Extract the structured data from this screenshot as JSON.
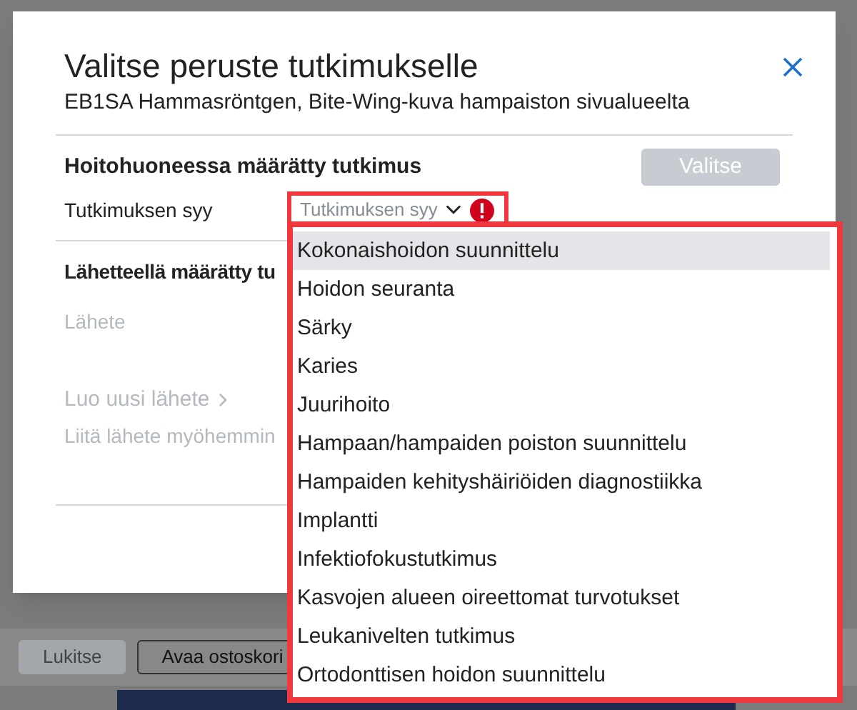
{
  "background": {
    "buttons": [
      {
        "label": "Lukitse",
        "disabled": true
      },
      {
        "label": "Avaa ostoskori",
        "disabled": false
      }
    ]
  },
  "dialog": {
    "title": "Valitse peruste tutkimukselle",
    "subtitle": "EB1SA Hammasröntgen, Bite-Wing-kuva hampaiston sivualueelta",
    "section_1": {
      "heading": "Hoitohuoneessa määrätty tutkimus",
      "button": {
        "label": "Valitse",
        "disabled": true
      },
      "field_label": "Tutkimuksen syy",
      "select": {
        "placeholder": "Tutkimuksen syy",
        "error": true,
        "expanded": true
      }
    },
    "section_2": {
      "heading": "Lähetteellä määrätty tu",
      "field_label": "Lähete",
      "link": "Luo uusi lähete",
      "note": "Liitä lähete myöhemmin"
    }
  },
  "dropdown": {
    "options": [
      {
        "label": "Kokonaishoidon suunnittelu",
        "selected": true
      },
      {
        "label": "Hoidon seuranta",
        "selected": false
      },
      {
        "label": "Särky",
        "selected": false
      },
      {
        "label": "Karies",
        "selected": false
      },
      {
        "label": "Juurihoito",
        "selected": false
      },
      {
        "label": "Hampaan/hampaiden poiston suunnittelu",
        "selected": false
      },
      {
        "label": "Hampaiden kehityshäiriöiden diagnostiikka",
        "selected": false
      },
      {
        "label": "Implantti",
        "selected": false
      },
      {
        "label": "Infektiofokustutkimus",
        "selected": false
      },
      {
        "label": "Kasvojen alueen oireettomat turvotukset",
        "selected": false
      },
      {
        "label": "Leukanivelten tutkimus",
        "selected": false
      },
      {
        "label": "Ortodonttisen hoidon suunnittelu",
        "selected": false
      }
    ]
  }
}
